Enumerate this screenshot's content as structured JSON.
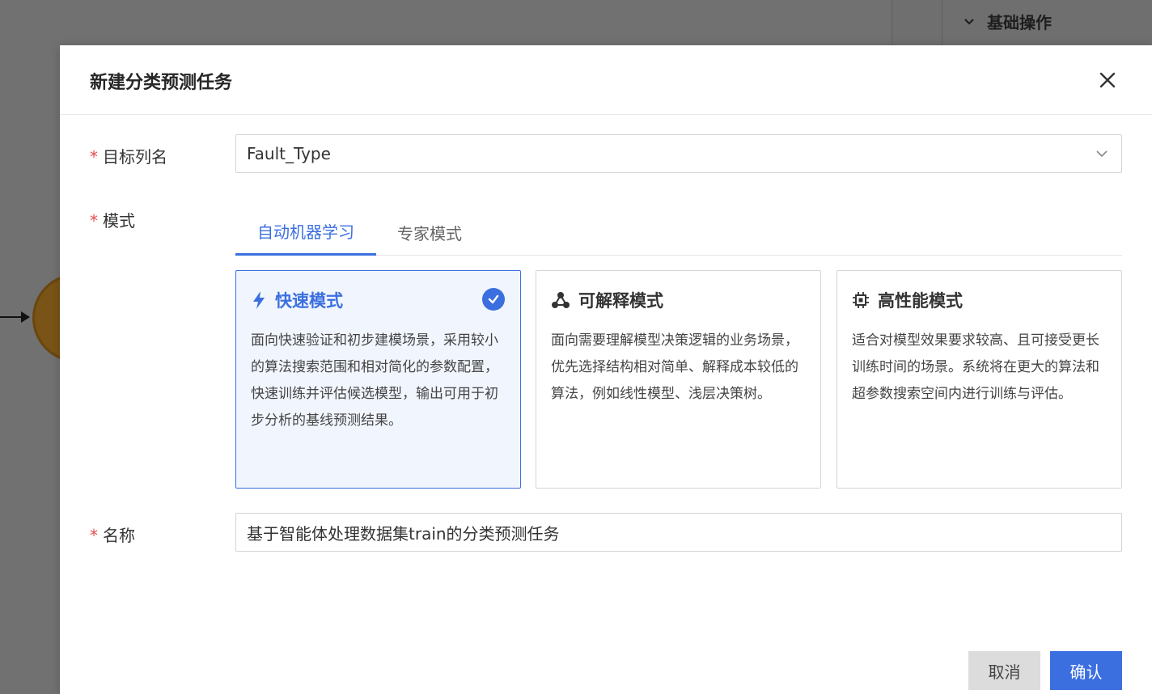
{
  "background": {
    "section_label": "基础操作"
  },
  "modal": {
    "title": "新建分类预测任务",
    "target_column": {
      "label": "目标列名",
      "value": "Fault_Type"
    },
    "mode": {
      "label": "模式",
      "tabs": [
        {
          "label": "自动机器学习",
          "active": true
        },
        {
          "label": "专家模式",
          "active": false
        }
      ],
      "cards": [
        {
          "title": "快速模式",
          "icon": "lightning-icon",
          "selected": true,
          "description": "面向快速验证和初步建模场景，采用较小的算法搜索范围和相对简化的参数配置，快速训练并评估候选模型，输出可用于初步分析的基线预测结果。"
        },
        {
          "title": "可解释模式",
          "icon": "network-icon",
          "selected": false,
          "description": "面向需要理解模型决策逻辑的业务场景，优先选择结构相对简单、解释成本较低的算法，例如线性模型、浅层决策树。"
        },
        {
          "title": "高性能模式",
          "icon": "chip-icon",
          "selected": false,
          "description": "适合对模型效果要求较高、且可接受更长训练时间的场景。系统将在更大的算法和超参数搜索空间内进行训练与评估。"
        }
      ]
    },
    "name": {
      "label": "名称",
      "value": "基于智能体处理数据集train的分类预测任务"
    },
    "buttons": {
      "cancel": "取消",
      "confirm": "确认"
    }
  },
  "colors": {
    "accent": "#3b6fe0",
    "required": "#e54b4b"
  }
}
